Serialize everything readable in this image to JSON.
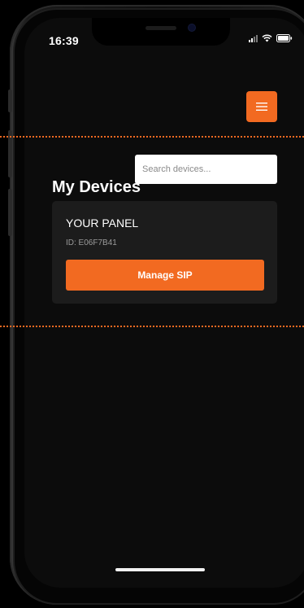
{
  "status_bar": {
    "time": "16:39",
    "icons": [
      "signal-icon",
      "wifi-icon",
      "battery-icon"
    ]
  },
  "header": {
    "menu_icon": "hamburger-menu-icon"
  },
  "main": {
    "title": "My Devices",
    "search": {
      "placeholder": "Search devices...",
      "value": ""
    },
    "devices": [
      {
        "name": "YOUR PANEL",
        "id_text": "ID: E06F7B41",
        "action_label": "Manage SIP"
      }
    ]
  },
  "colors": {
    "accent": "#f26a21",
    "screen_background": "#0c0c0c",
    "card_background": "#1c1c1c",
    "text_primary": "#ffffff",
    "text_secondary": "#9b9b9b"
  }
}
